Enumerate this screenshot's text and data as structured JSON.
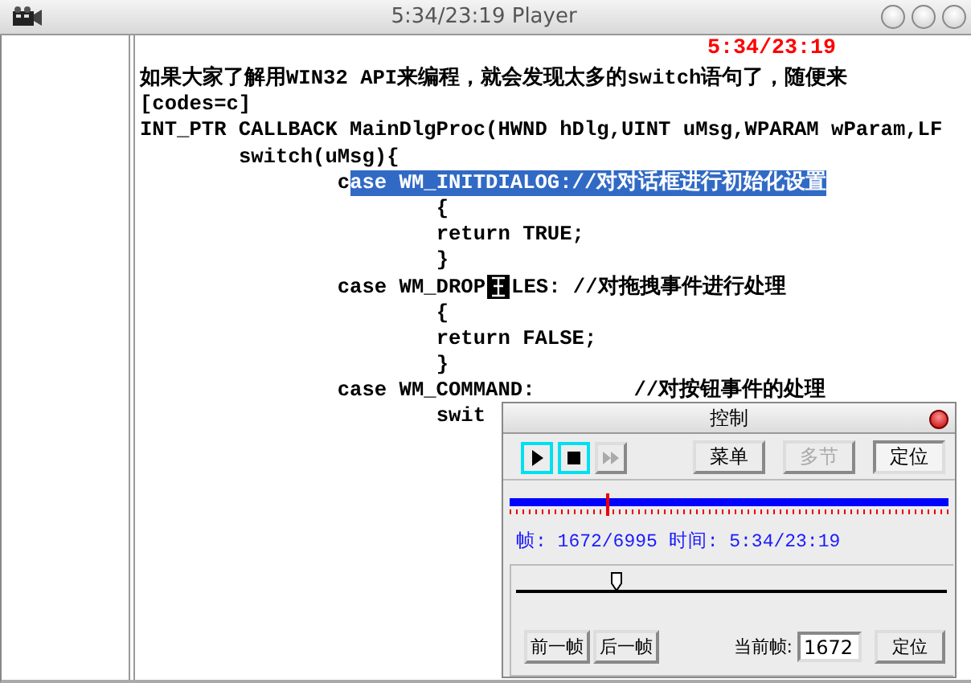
{
  "window": {
    "title": "5:34/23:19 Player"
  },
  "overlay_time": "5:34/23:19",
  "lines": [
    {
      "segments": [
        {
          "kind": "text",
          "text": "如果大家了解用WIN32 API来编程，就会发现太多的switch语句了，随便来"
        }
      ]
    },
    {
      "segments": [
        {
          "kind": "text",
          "text": "[codes=c]"
        }
      ]
    },
    {
      "segments": [
        {
          "kind": "text",
          "text": "INT_PTR CALLBACK MainDlgProc(HWND hDlg,UINT uMsg,WPARAM wParam,LF"
        }
      ]
    },
    {
      "segments": [
        {
          "kind": "text",
          "text": "\tswitch(uMsg){"
        }
      ]
    },
    {
      "segments": [
        {
          "kind": "text",
          "text": "\t\tc"
        },
        {
          "kind": "selection",
          "text": "ase WM_INITDIALOG://对对话框进行初始化设置"
        }
      ]
    },
    {
      "segments": [
        {
          "kind": "text",
          "text": "\t\t\t{"
        }
      ]
    },
    {
      "segments": [
        {
          "kind": "text",
          "text": "\t\t\treturn TRUE;"
        }
      ]
    },
    {
      "segments": [
        {
          "kind": "text",
          "text": "\t\t\t}"
        }
      ]
    },
    {
      "segments": [
        {
          "kind": "text",
          "text": "\t\tcase WM_DROP"
        },
        {
          "kind": "cursor"
        },
        {
          "kind": "text",
          "text": "LES: //对拖拽事件进行处理"
        }
      ]
    },
    {
      "segments": [
        {
          "kind": "text",
          "text": "\t\t\t{"
        }
      ]
    },
    {
      "segments": [
        {
          "kind": "text",
          "text": "\t\t\treturn FALSE;"
        }
      ]
    },
    {
      "segments": [
        {
          "kind": "text",
          "text": "\t\t\t}"
        }
      ]
    },
    {
      "segments": [
        {
          "kind": "text",
          "text": "\t\tcase WM_COMMAND:\t//对按钮事件的处理"
        }
      ]
    },
    {
      "segments": [
        {
          "kind": "text",
          "text": "\t\t\tswit"
        }
      ]
    }
  ],
  "dialog": {
    "title": "控制",
    "transport": [
      {
        "kind": "play",
        "highlighted": true,
        "disabled": false
      },
      {
        "kind": "stop",
        "highlighted": true,
        "disabled": false
      },
      {
        "kind": "forward",
        "highlighted": false,
        "disabled": true
      }
    ],
    "buttons": [
      {
        "label": "菜单",
        "disabled": false,
        "selected": false
      },
      {
        "label": "多节",
        "disabled": true,
        "selected": false
      },
      {
        "label": "定位",
        "disabled": false,
        "selected": true
      }
    ],
    "progress": {
      "level": 0.22
    },
    "info": "帧: 1672/6995 时间: 5:34/23:19",
    "slider": {
      "level": 0.22
    },
    "prev_button": "前一帧",
    "next_button": "后一帧",
    "frame_label": "当前帧:",
    "frame_value": "1672",
    "go_button": "定位"
  }
}
